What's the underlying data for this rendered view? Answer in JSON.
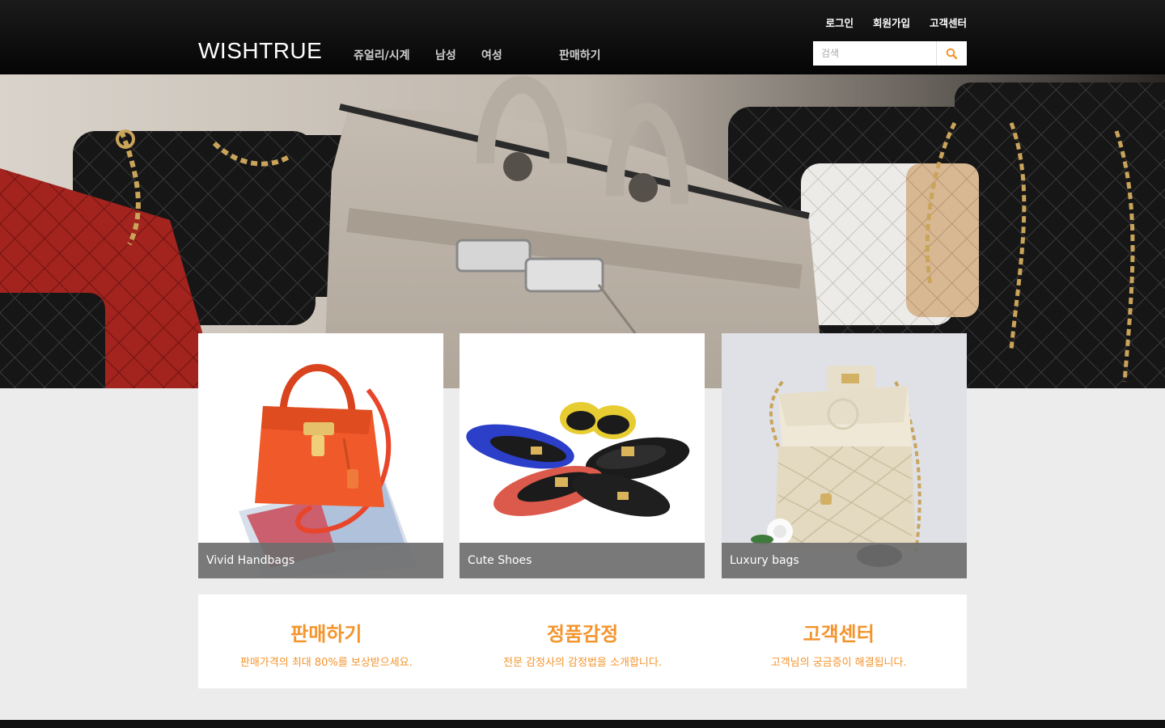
{
  "header": {
    "logo": "WISHTRUE",
    "util_nav": [
      "로그인",
      "회원가입",
      "고객센터"
    ],
    "main_nav": [
      "쥬얼리/시계",
      "남성",
      "여성",
      "판매하기"
    ],
    "search": {
      "placeholder": "검색",
      "icon": "search-icon"
    }
  },
  "hero": {
    "image": "designer-handbags-banner"
  },
  "categories": [
    {
      "label": "Vivid Handbags",
      "image": "orange-handbag"
    },
    {
      "label": "Cute Shoes",
      "image": "flat-shoes"
    },
    {
      "label": "Luxury bags",
      "image": "quilted-chain-bag"
    }
  ],
  "services": [
    {
      "title": "판매하기",
      "desc": "판매가격의 최대 80%를 보상받으세요."
    },
    {
      "title": "정품감정",
      "desc": "전문 감정사의 감정법을 소개합니다."
    },
    {
      "title": "고객센터",
      "desc": "고객님의 궁금증이 해결됩니다."
    }
  ],
  "colors": {
    "accent": "#f4942d",
    "header_bg": "#0a0a0a",
    "page_bg": "#ececec"
  }
}
